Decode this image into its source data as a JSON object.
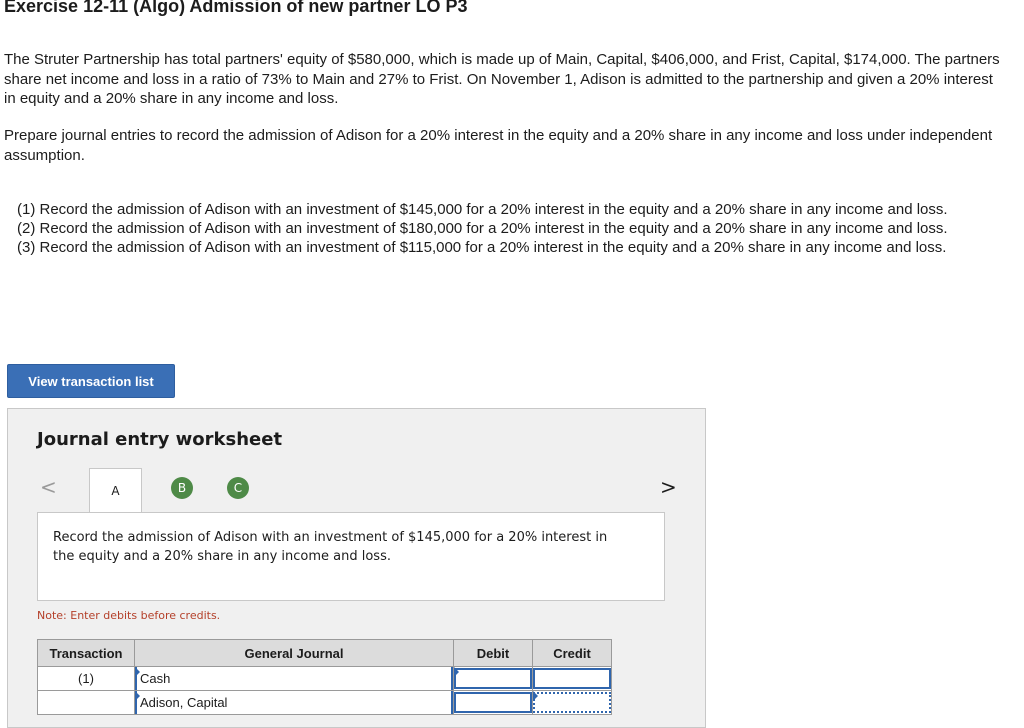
{
  "exercise": {
    "title": "Exercise 12-11 (Algo) Admission of new partner LO P3",
    "intro": "The Struter Partnership has total partners' equity of $580,000, which is made up of Main, Capital, $406,000, and Frist, Capital, $174,000. The partners share net income and loss in a ratio of 73% to Main and 27% to Frist. On November 1, Adison is admitted to the partnership and given a 20% interest in equity and a 20% share in any income and loss.",
    "instruction": "Prepare journal entries to record the admission of Adison for a 20% interest in the equity and a 20% share in any income and loss under independent assumption.",
    "requirements": [
      "(1) Record the admission of Adison with an investment of $145,000 for a 20% interest in the equity and a 20% share in any income and loss.",
      "(2) Record the admission of Adison with an investment of $180,000 for a 20% interest in the equity and a 20% share in any income and loss.",
      "(3) Record the admission of Adison with an investment of $115,000 for a 20% interest in the equity and a 20% share in any income and loss."
    ]
  },
  "view_button": {
    "label": "View transaction list"
  },
  "worksheet": {
    "title": "Journal entry worksheet",
    "prev_icon": "<",
    "next_icon": ">",
    "tabs": [
      "A",
      "B",
      "C"
    ],
    "active_tab": "A",
    "tab_completed_color": "#4e8a47",
    "prompt": "Record the admission of Adison with an investment of $145,000 for a 20% interest in the equity and a 20% share in any income and loss.",
    "note": "Note: Enter debits before credits.",
    "table": {
      "headers": {
        "transaction": "Transaction",
        "journal": "General Journal",
        "debit": "Debit",
        "credit": "Credit"
      },
      "rows": [
        {
          "transaction": "(1)",
          "account": "Cash",
          "debit": "",
          "credit": ""
        },
        {
          "transaction": "",
          "account": "Adison, Capital",
          "debit": "",
          "credit": ""
        }
      ]
    }
  },
  "colors": {
    "button": "#3a6fb6",
    "input_border": "#2f65ad",
    "note": "#b4402a"
  }
}
